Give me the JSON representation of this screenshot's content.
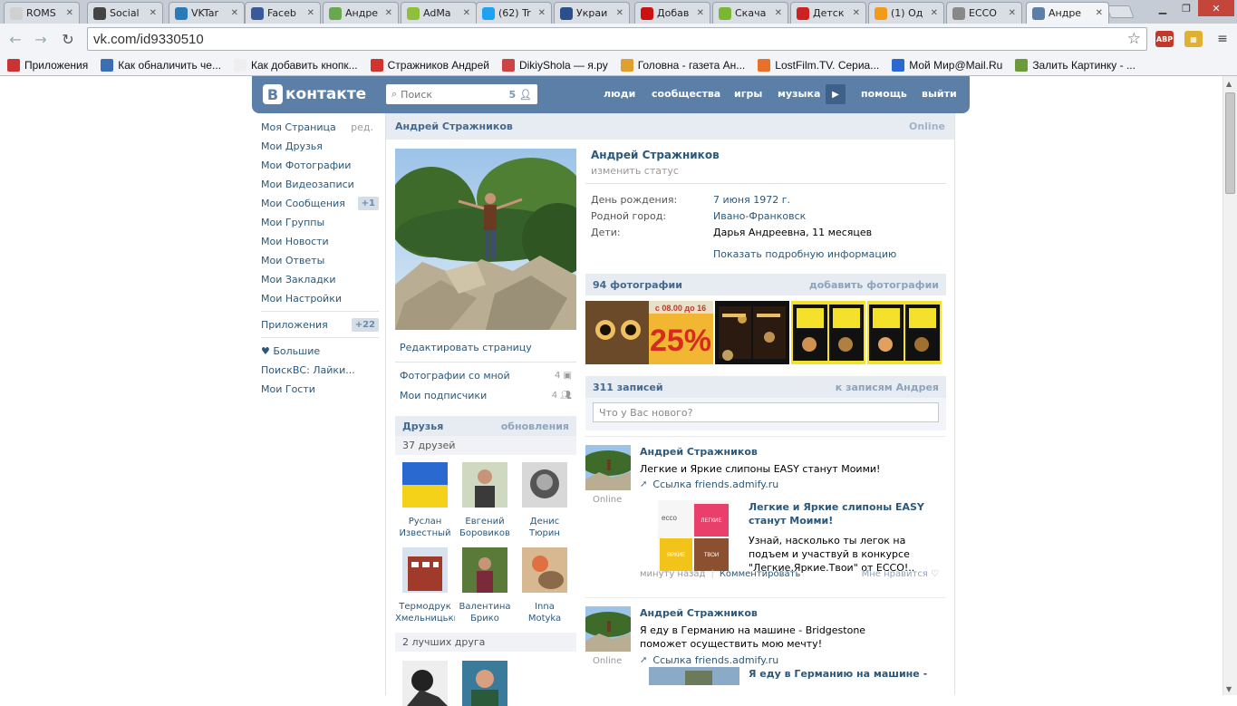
{
  "browser": {
    "tabs": [
      {
        "title": "ROMS",
        "color": "#d0d0d0"
      },
      {
        "title": "Social",
        "color": "#444444"
      },
      {
        "title": "VKTar",
        "color": "#2a7ab8"
      },
      {
        "title": "Faceb",
        "color": "#3b5998"
      },
      {
        "title": "Андре",
        "color": "#6aa84f"
      },
      {
        "title": "AdMa",
        "color": "#8fbf3a"
      },
      {
        "title": "(62) Tr",
        "color": "#1da1f2"
      },
      {
        "title": "Украи",
        "color": "#2a4f8a"
      },
      {
        "title": "Добав",
        "color": "#cc1111"
      },
      {
        "title": "Скача",
        "color": "#7ab733"
      },
      {
        "title": "Детск",
        "color": "#cc2222"
      },
      {
        "title": "(1) Од",
        "color": "#f29a1a"
      },
      {
        "title": "ECCO",
        "color": "#888888"
      },
      {
        "title": "Андре",
        "color": "#5b7fa6"
      }
    ],
    "url": "vk.com/id9330510",
    "ext_abp": "ABP",
    "bookmarks": [
      {
        "label": "Приложения",
        "color": "#cc3333"
      },
      {
        "label": "Как обналичить че...",
        "color": "#3b6fb3"
      },
      {
        "label": "Как добавить кнопк...",
        "color": "#eeeeee"
      },
      {
        "label": "Стражников Андрей",
        "color": "#d0342c"
      },
      {
        "label": "DikiyShola — я.ру",
        "color": "#cc4444"
      },
      {
        "label": "Головна - газета Ан...",
        "color": "#e0a030"
      },
      {
        "label": "LostFilm.TV. Сериа...",
        "color": "#e8702a"
      },
      {
        "label": "Мой Мир@Mail.Ru",
        "color": "#2a6ad0"
      },
      {
        "label": "Залить Картинку - ...",
        "color": "#6a9a3a"
      }
    ]
  },
  "vk": {
    "logo_letter": "В",
    "logo_text": "контакте",
    "search_placeholder": "Поиск",
    "search_count": "5",
    "nav": [
      "люди",
      "сообщества",
      "игры",
      "музыка",
      "помощь",
      "выйти"
    ],
    "menu": [
      {
        "label": "Моя Страница",
        "extra": "ред."
      },
      {
        "label": "Мои Друзья"
      },
      {
        "label": "Мои Фотографии"
      },
      {
        "label": "Мои Видеозаписи"
      },
      {
        "label": "Мои Сообщения",
        "badge": "+1"
      },
      {
        "label": "Мои Группы"
      },
      {
        "label": "Мои Новости"
      },
      {
        "label": "Мои Ответы"
      },
      {
        "label": "Мои Закладки"
      },
      {
        "label": "Мои Настройки"
      }
    ],
    "apps": {
      "label": "Приложения",
      "badge": "+22"
    },
    "apps_list": [
      "♥ Большие",
      "ПоискВС: Лайки...",
      "Мои Гости"
    ],
    "page_name": "Андрей Стражников",
    "online": "Online",
    "edit_page": "Редактировать страницу",
    "photos_with_me": {
      "label": "Фотографии со мной",
      "count": "4"
    },
    "followers": {
      "label": "Мои подписчики",
      "count": "4"
    },
    "friends_head": "Друзья",
    "friends_updates": "обновления",
    "friends_count": "37 друзей",
    "friends": [
      {
        "first": "Руслан",
        "last": "Известный"
      },
      {
        "first": "Евгений",
        "last": "Боровиков"
      },
      {
        "first": "Денис",
        "last": "Тюрин"
      },
      {
        "first": "Термодрук",
        "last": "Хмельницький"
      },
      {
        "first": "Валентина",
        "last": "Брико"
      },
      {
        "first": "Inna",
        "last": "Motyka"
      }
    ],
    "best_friends": "2 лучших друга",
    "profile": {
      "name": "Андрей Стражников",
      "status": "изменить статус",
      "info": [
        {
          "k": "День рождения:",
          "v": "7 июня 1972 г.",
          "link": true
        },
        {
          "k": "Родной город:",
          "v": "Ивано-Франковск",
          "link": true
        },
        {
          "k": "Дети:",
          "v": "Дарья Андреевна, 11 месяцев",
          "link": false
        }
      ],
      "show_more": "Показать подробную информацию"
    },
    "photos_head": "94 фотографии",
    "photos_add": "добавить фотографии",
    "photo_banner_text": "25%",
    "photo_banner_time": "с 08.00 до 16",
    "wall_head": "311 записей",
    "wall_link": "к записям Андрея",
    "new_post_placeholder": "Что у Вас нового?",
    "posts": [
      {
        "author": "Андрей Стражников",
        "text": "Легкие и Яркие слипоны EASY станут Моими!",
        "online": "Online",
        "link": "Ссылка friends.admify.ru",
        "card_title": "Легкие и Яркие слипоны EASY станут Моими!",
        "card_desc": "Узнай, насколько ты легок на подъем и участвуй в конкурсе \"Легкие.Яркие.Твои\" от ECCO!..",
        "card_labels": [
          "ecco",
          "ЛЕГКИЕ",
          "ЯРКИЕ",
          "ТВОИ"
        ],
        "time": "минуту назад",
        "comment": "Комментировать",
        "like": "Мне нравится ♡"
      },
      {
        "author": "Андрей Стражников",
        "text": "Я еду в Германию на машине - Bridgestone поможет осуществить мою мечту!",
        "online": "Online",
        "link": "Ссылка friends.admify.ru",
        "card_title": "Я еду в Германию на машине -"
      }
    ]
  }
}
